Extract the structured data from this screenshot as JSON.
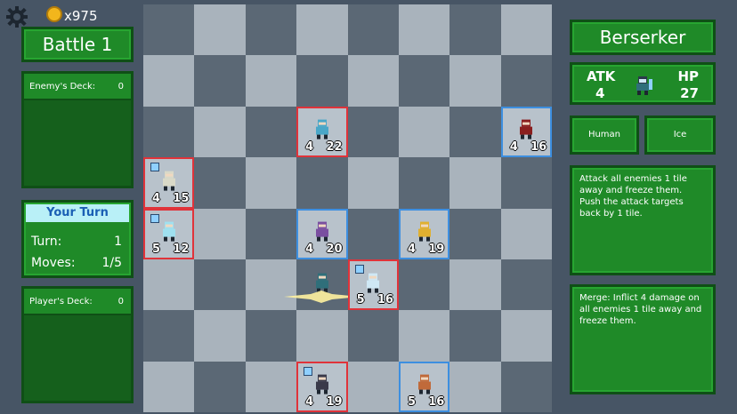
{
  "hud": {
    "coin_count": "x975",
    "battle_title": "Battle 1"
  },
  "enemy_deck": {
    "label": "Enemy's Deck:",
    "count": "0"
  },
  "turn_panel": {
    "header": "Your Turn",
    "turn_label": "Turn:",
    "turn_value": "1",
    "moves_label": "Moves:",
    "moves_value": "1/5"
  },
  "player_deck": {
    "label": "Player's Deck:",
    "count": "0"
  },
  "unit_info": {
    "name": "Berserker",
    "atk_label": "ATK",
    "atk_value": "4",
    "hp_label": "HP",
    "hp_value": "27",
    "tag1": "Human",
    "tag2": "Ice",
    "ability": "Attack all enemies 1 tile away and freeze them. Push the attack targets back by 1 tile.",
    "merge": "Merge: Inflict 4 damage on all enemies 1 tile away and freeze them."
  },
  "board": {
    "rows": 8,
    "cols": 8,
    "units": [
      {
        "row": 2,
        "col": 3,
        "side": "enemy",
        "atk": "4",
        "hp": "22",
        "color": "#4aa7c8"
      },
      {
        "row": 2,
        "col": 7,
        "side": "player",
        "atk": "4",
        "hp": "16",
        "color": "#8a1e1e"
      },
      {
        "row": 3,
        "col": 0,
        "side": "enemy",
        "atk": "4",
        "hp": "15",
        "color": "#d9d9c8",
        "frozen": true
      },
      {
        "row": 4,
        "col": 0,
        "side": "enemy",
        "atk": "5",
        "hp": "12",
        "color": "#9fe0ef",
        "frozen": true
      },
      {
        "row": 4,
        "col": 3,
        "side": "player",
        "atk": "4",
        "hp": "20",
        "color": "#7a4fa0"
      },
      {
        "row": 4,
        "col": 5,
        "side": "player",
        "atk": "4",
        "hp": "19",
        "color": "#e0b030"
      },
      {
        "row": 5,
        "col": 4,
        "side": "enemy",
        "atk": "5",
        "hp": "16",
        "color": "#cfe8f5",
        "frozen": true
      },
      {
        "row": 5,
        "col": 3,
        "side": "bare",
        "atk": "",
        "hp": "",
        "color": "#2f6f7a"
      },
      {
        "row": 7,
        "col": 3,
        "side": "enemy",
        "atk": "4",
        "hp": "19",
        "color": "#3a3a4a",
        "frozen": true
      },
      {
        "row": 7,
        "col": 5,
        "side": "player",
        "atk": "5",
        "hp": "16",
        "color": "#c06a3a"
      }
    ]
  }
}
